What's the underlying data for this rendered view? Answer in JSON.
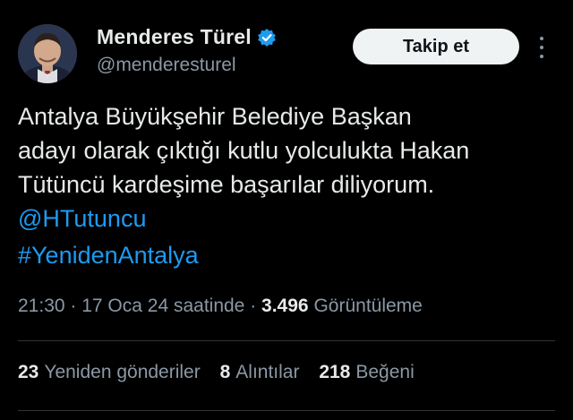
{
  "author": {
    "display_name": "Menderes Türel",
    "handle": "@menderesturel",
    "verified_icon": "verified-badge-icon",
    "verified_color": "#1d9bf0"
  },
  "follow_button": {
    "label": "Takip et"
  },
  "more_menu": {
    "icon": "more-vertical-icon"
  },
  "tweet": {
    "lines": [
      "Antalya Büyükşehir Belediye Başkan",
      "adayı olarak çıktığı kutlu yolculukta Hakan",
      "Tütüncü kardeşime başarılar diliyorum."
    ],
    "mention": "@HTutuncu",
    "hashtag": "#YenidenAntalya"
  },
  "meta": {
    "time": "21:30",
    "separator": " · ",
    "date": "17 Oca 24 saatinde",
    "views_count": "3.496",
    "views_label": "Görüntüleme"
  },
  "stats": {
    "reposts": {
      "count": "23",
      "label": "Yeniden gönderiler"
    },
    "quotes": {
      "count": "8",
      "label": "Alıntılar"
    },
    "likes": {
      "count": "218",
      "label": "Beğeni"
    }
  },
  "colors": {
    "background": "#000000",
    "text": "#e7e9ea",
    "secondary": "#8b98a5",
    "link": "#1d9bf0",
    "button_bg": "#eff3f4"
  }
}
